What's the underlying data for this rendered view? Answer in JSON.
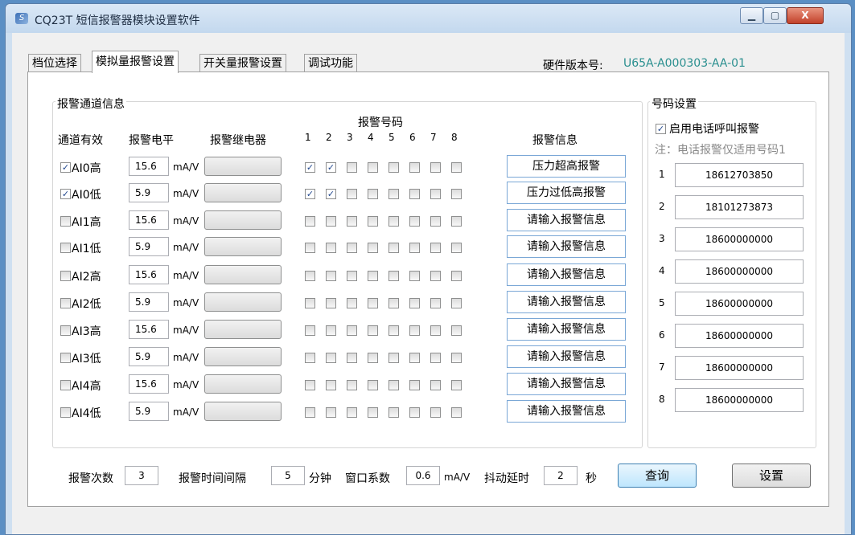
{
  "window": {
    "title": "CQ23T 短信报警器模块设置软件",
    "buttons": {
      "minimize": "▁",
      "maximize": "▢",
      "close": "X"
    }
  },
  "tabs": [
    {
      "label": "档位选择",
      "active": false
    },
    {
      "label": "模拟量报警设置",
      "active": true
    },
    {
      "label": "开关量报警设置",
      "active": false
    },
    {
      "label": "调试功能",
      "active": false
    }
  ],
  "hardware": {
    "label": "硬件版本号:",
    "value": "U65A-A000303-AA-01"
  },
  "alarm_channels": {
    "title": "报警通道信息",
    "headers": {
      "enabled": "通道有效",
      "level": "报警电平",
      "relay": "报警继电器",
      "numbers": "报警号码",
      "info": "报警信息"
    },
    "number_columns": [
      "1",
      "2",
      "3",
      "4",
      "5",
      "6",
      "7",
      "8"
    ],
    "rows": [
      {
        "name": "AI0高",
        "enabled": true,
        "level": "15.6",
        "unit": "mA/V",
        "relay": "",
        "numbers": [
          true,
          true,
          false,
          false,
          false,
          false,
          false,
          false
        ],
        "info": "压力超高报警"
      },
      {
        "name": "AI0低",
        "enabled": true,
        "level": "5.9",
        "unit": "mA/V",
        "relay": "",
        "numbers": [
          true,
          true,
          false,
          false,
          false,
          false,
          false,
          false
        ],
        "info": "压力过低高报警"
      },
      {
        "name": "AI1高",
        "enabled": false,
        "level": "15.6",
        "unit": "mA/V",
        "relay": "",
        "numbers": [
          false,
          false,
          false,
          false,
          false,
          false,
          false,
          false
        ],
        "info": "请输入报警信息"
      },
      {
        "name": "AI1低",
        "enabled": false,
        "level": "5.9",
        "unit": "mA/V",
        "relay": "",
        "numbers": [
          false,
          false,
          false,
          false,
          false,
          false,
          false,
          false
        ],
        "info": "请输入报警信息"
      },
      {
        "name": "AI2高",
        "enabled": false,
        "level": "15.6",
        "unit": "mA/V",
        "relay": "",
        "numbers": [
          false,
          false,
          false,
          false,
          false,
          false,
          false,
          false
        ],
        "info": "请输入报警信息"
      },
      {
        "name": "AI2低",
        "enabled": false,
        "level": "5.9",
        "unit": "mA/V",
        "relay": "",
        "numbers": [
          false,
          false,
          false,
          false,
          false,
          false,
          false,
          false
        ],
        "info": "请输入报警信息"
      },
      {
        "name": "AI3高",
        "enabled": false,
        "level": "15.6",
        "unit": "mA/V",
        "relay": "",
        "numbers": [
          false,
          false,
          false,
          false,
          false,
          false,
          false,
          false
        ],
        "info": "请输入报警信息"
      },
      {
        "name": "AI3低",
        "enabled": false,
        "level": "5.9",
        "unit": "mA/V",
        "relay": "",
        "numbers": [
          false,
          false,
          false,
          false,
          false,
          false,
          false,
          false
        ],
        "info": "请输入报警信息"
      },
      {
        "name": "AI4高",
        "enabled": false,
        "level": "15.6",
        "unit": "mA/V",
        "relay": "",
        "numbers": [
          false,
          false,
          false,
          false,
          false,
          false,
          false,
          false
        ],
        "info": "请输入报警信息"
      },
      {
        "name": "AI4低",
        "enabled": false,
        "level": "5.9",
        "unit": "mA/V",
        "relay": "",
        "numbers": [
          false,
          false,
          false,
          false,
          false,
          false,
          false,
          false
        ],
        "info": "请输入报警信息"
      }
    ]
  },
  "phone_settings": {
    "title": "号码设置",
    "enable_call_label": "启用电话呼叫报警",
    "enable_call": true,
    "note": "注：电话报警仅适用号码1",
    "numbers": [
      {
        "index": "1",
        "value": "18612703850"
      },
      {
        "index": "2",
        "value": "18101273873"
      },
      {
        "index": "3",
        "value": "18600000000"
      },
      {
        "index": "4",
        "value": "18600000000"
      },
      {
        "index": "5",
        "value": "18600000000"
      },
      {
        "index": "6",
        "value": "18600000000"
      },
      {
        "index": "7",
        "value": "18600000000"
      },
      {
        "index": "8",
        "value": "18600000000"
      }
    ]
  },
  "footer": {
    "alarm_count_label": "报警次数",
    "alarm_count": "3",
    "interval_label": "报警时间间隔",
    "interval": "5",
    "interval_unit": "分钟",
    "window_coef_label": "窗口系数",
    "window_coef": "0.6",
    "window_coef_unit": "mA/V",
    "debounce_label": "抖动延时",
    "debounce": "2",
    "debounce_unit": "秒",
    "query_button": "查询",
    "set_button": "设置"
  },
  "colors": {
    "accent": "#2a8f8f",
    "focus": "#3c7fb1"
  }
}
